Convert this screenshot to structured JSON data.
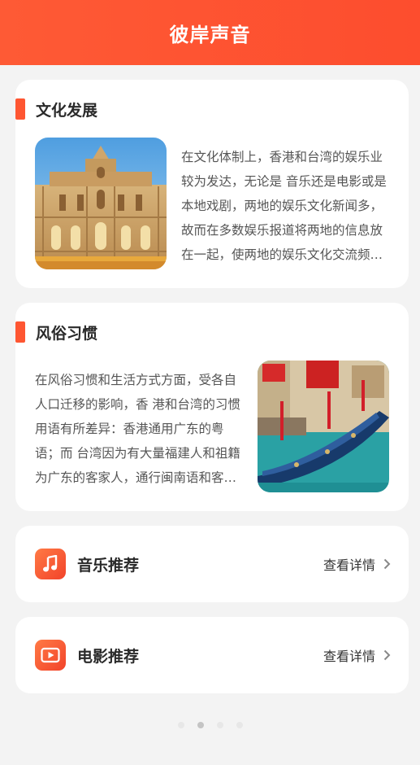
{
  "header": {
    "title": "彼岸声音"
  },
  "sections": [
    {
      "title": "文化发展",
      "image_icon": "ruins-facade-photo",
      "text": "在文化体制上，香港和台湾的娱乐业较为发达，无论是 音乐还是电影或是本地戏剧，两地的娱乐文化新闻多， 故而在多数娱乐报道将两地的信息放在一起，使两地的娱乐文化交流频繁。"
    },
    {
      "title": "风俗习惯",
      "image_icon": "gondola-canal-photo",
      "text": "在风俗习惯和生活方式方面，受各自人口迁移的影响，香 港和台湾的习惯用语有所差异：香港通用广东的粤语；而 台湾因为有大量福建人和祖籍为广东的客家人，通行闽南语和客家话。"
    }
  ],
  "links": [
    {
      "label": "音乐推荐",
      "icon": "music-note-icon",
      "action": "查看详情"
    },
    {
      "label": "电影推荐",
      "icon": "video-play-icon",
      "action": "查看详情"
    }
  ],
  "pager": {
    "count": 4,
    "active": 1
  },
  "colors": {
    "accent": "#fe5632",
    "header": "#fd4d2e",
    "background": "#f3f3f3"
  }
}
